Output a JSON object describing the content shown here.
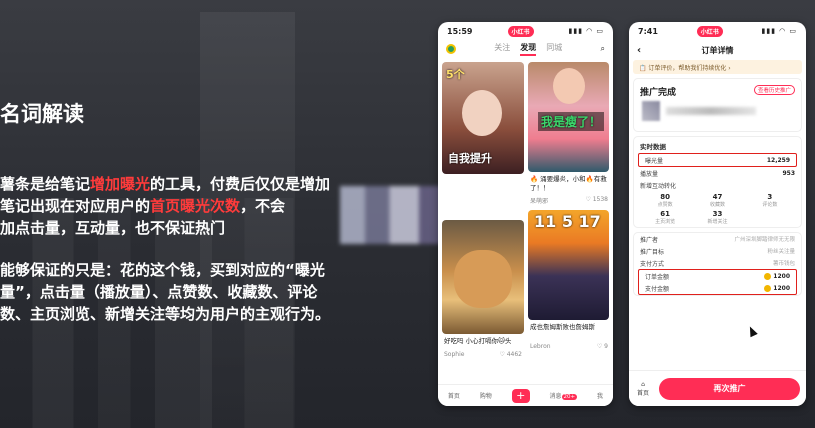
{
  "slide": {
    "title": "名词解读",
    "p1_line1_a": "薯条是给笔记",
    "p1_line1_hl": "增加曝光",
    "p1_line1_b": "的工具，付费后仅仅是增加",
    "p1_line2_a": "笔记出现在对应用户的",
    "p1_line2_hl": "首页曝光次数",
    "p1_line2_b": "，不会",
    "p1_line3": "加点击量，互动量，也不保证热门",
    "p2_line1": "能够保证的只是：花的这个钱，买到对应的“曝光",
    "p2_line2": "量”，点击量（播放量）、点赞数、收藏数、评论",
    "p2_line3": "数、主页浏览、新增关注等均为用户的主观行为。"
  },
  "phone1": {
    "time": "15:59",
    "pill": "小红书",
    "signal": "▮▮▮ ◠ ▭",
    "tabs": [
      "关注",
      "发现",
      "同城"
    ],
    "card1_text_top": "5个",
    "card1_text_bottom": "自我提升",
    "card2_text": "我是瘦了！",
    "card2_caption": "🔥 涌要爆炎，小和🔥有救了！！",
    "card2_author": "呆萌邪",
    "card2_likes": "♡ 1538",
    "card3_caption": "好吃吗 小心打嗝你🐱头",
    "card3_author": "Sophie",
    "card3_likes": "♡ 4462",
    "card4_text": "11 5 17",
    "card4_caption": "成也詹姆斯败也詹姆斯",
    "card4_author": "Lebron",
    "card4_likes": "♡ 9",
    "nav": [
      "首页",
      "购物",
      "+",
      "消息",
      "我"
    ],
    "msg_badge": "20+"
  },
  "phone2": {
    "time": "7:41",
    "pill": "小红书",
    "signal": "▮▮▮ ◠ ▭",
    "back": "‹",
    "title": "订单详情",
    "notice": "📋 订单评价，帮助我们持续优化 ›",
    "promo_title": "推广完成",
    "promo_tag": "查看历史推广",
    "realtime": "实时数据",
    "exposure_label": "曝光量",
    "exposure_value": "12,259",
    "play_label": "播放量",
    "play_value": "953",
    "new_interact": "新增互动转化",
    "stats": [
      {
        "num": "80",
        "lab": "点赞数"
      },
      {
        "num": "47",
        "lab": "收藏数"
      },
      {
        "num": "3",
        "lab": "评论数"
      },
      {
        "num": "61",
        "lab": "主页浏览"
      },
      {
        "num": "33",
        "lab": "新增关注"
      },
      {
        "num": "",
        "lab": ""
      }
    ],
    "promoter_label": "推广者",
    "promoter_value": "广州深圳脚踏律师无无限",
    "target_label": "推广目标",
    "target_value": "粉丝关注量",
    "pay_label": "支付方式",
    "pay_value": "薯币钱包",
    "order_amount_label": "订单金额",
    "order_amount_value": "1200",
    "paid_label": "支付金额",
    "paid_value": "1200",
    "home": "首页",
    "cta": "再次推广"
  },
  "colors": {
    "accent": "#ff2d55",
    "highlight": "#ff3b3b",
    "box": "#e0201c"
  }
}
